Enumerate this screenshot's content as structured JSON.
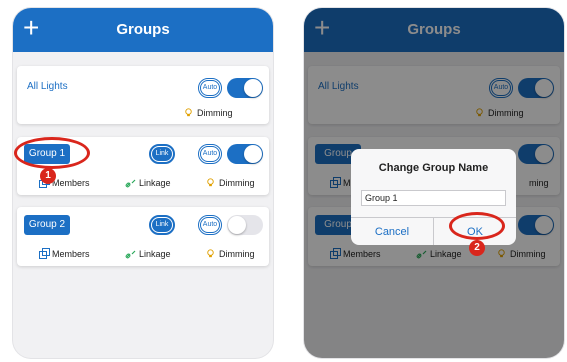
{
  "app": {
    "title": "Groups",
    "add_label": "+",
    "colors": {
      "header": "#1c6fc4",
      "accent": "#1c6fc4",
      "annotation": "#d9261c"
    }
  },
  "all_lights": {
    "label": "All Lights",
    "auto_label": "Auto",
    "toggle_on": true,
    "dimming_label": "Dimming"
  },
  "groups": [
    {
      "name": "Group 1",
      "link_label": "Link",
      "auto_label": "Auto",
      "toggle_on": true,
      "members_label": "Members",
      "linkage_label": "Linkage",
      "dimming_label": "Dimming"
    },
    {
      "name": "Group 2",
      "link_label": "Link",
      "auto_label": "Auto",
      "toggle_on": false,
      "members_label": "Members",
      "linkage_label": "Linkage",
      "dimming_label": "Dimming"
    }
  ],
  "dialog": {
    "title": "Change Group Name",
    "input_value": "Group 1",
    "cancel_label": "Cancel",
    "ok_label": "OK"
  },
  "annotations": {
    "step1": "1",
    "step2": "2"
  },
  "obscured": {
    "group1_partial": "Group",
    "group2_partial": "Group",
    "members_partial": "M",
    "dimming_partial": "ming"
  }
}
